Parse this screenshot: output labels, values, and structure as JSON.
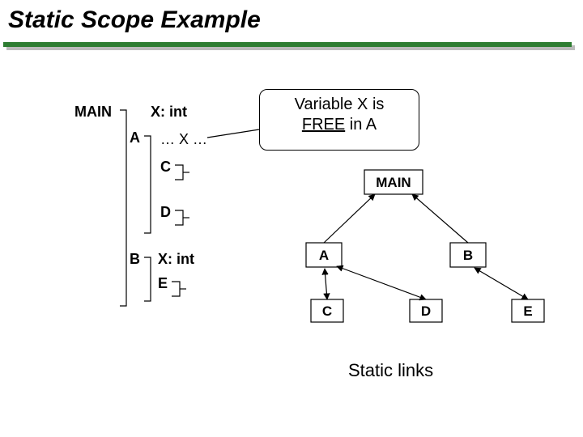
{
  "title": "Static Scope Example",
  "left_tree": {
    "main": "MAIN",
    "xint1": "X: int",
    "A": "A",
    "xref": "… X …",
    "C": "C",
    "D": "D",
    "B": "B",
    "xint2": "X: int",
    "E": "E"
  },
  "callout": {
    "line1": "Variable X is",
    "free_word": "FREE",
    "line2_rest": " in A"
  },
  "right_tree": {
    "MAIN": "MAIN",
    "A": "A",
    "B": "B",
    "C": "C",
    "D": "D",
    "E": "E"
  },
  "caption": "Static links"
}
